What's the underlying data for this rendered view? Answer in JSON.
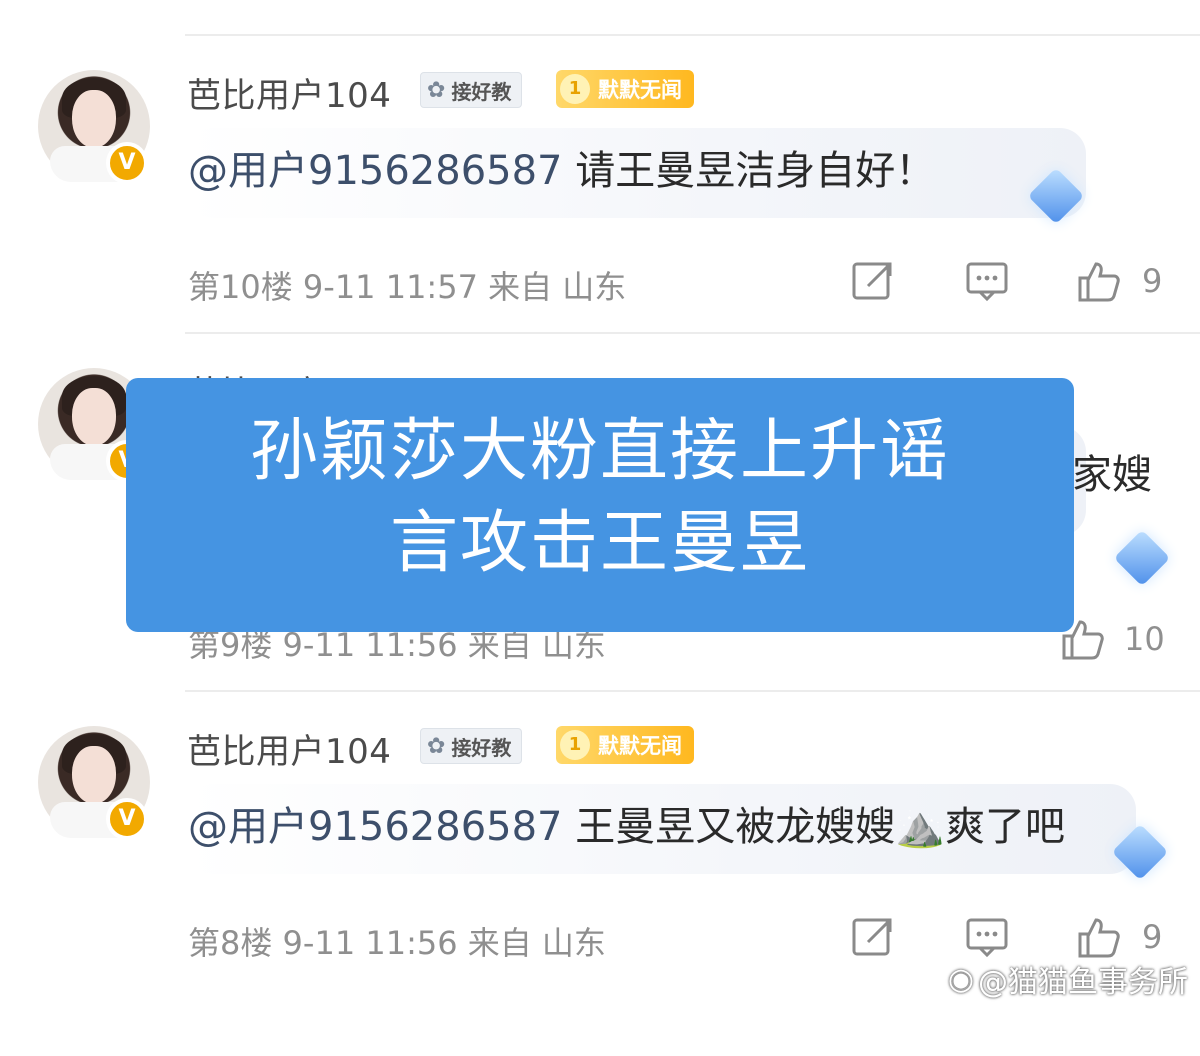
{
  "comments": [
    {
      "username": "芭比用户104",
      "teach_badge": "接好教",
      "rank_level": "1",
      "rank_label": "默默无闻",
      "mention": "@用户9156286587",
      "text": "请王曼昱洁身自好！",
      "floor": "第10楼",
      "datetime": "9-11 11:57",
      "location": "来自 山东",
      "likes": "9"
    },
    {
      "username": "芭比用户104",
      "partial_text": "家嫂",
      "floor": "第9楼",
      "datetime": "9-11 11:56",
      "location": "来自 山东",
      "likes": "10"
    },
    {
      "username": "芭比用户104",
      "teach_badge": "接好教",
      "rank_level": "1",
      "rank_label": "默默无闻",
      "mention": "@用户9156286587",
      "text": "王曼昱又被龙嫂嫂⛰️爽了吧",
      "floor": "第8楼",
      "datetime": "9-11 11:56",
      "location": "来自 山东",
      "likes": "9"
    }
  ],
  "overlay": {
    "line1": "孙颖莎大粉直接上升谣",
    "line2": "言攻击王曼昱"
  },
  "watermark": "@猫猫鱼事务所",
  "icons": {
    "share": "share-icon",
    "reply": "comment-icon",
    "like": "thumbs-up-icon",
    "verified": "verified-badge-icon",
    "gem": "diamond-icon"
  }
}
